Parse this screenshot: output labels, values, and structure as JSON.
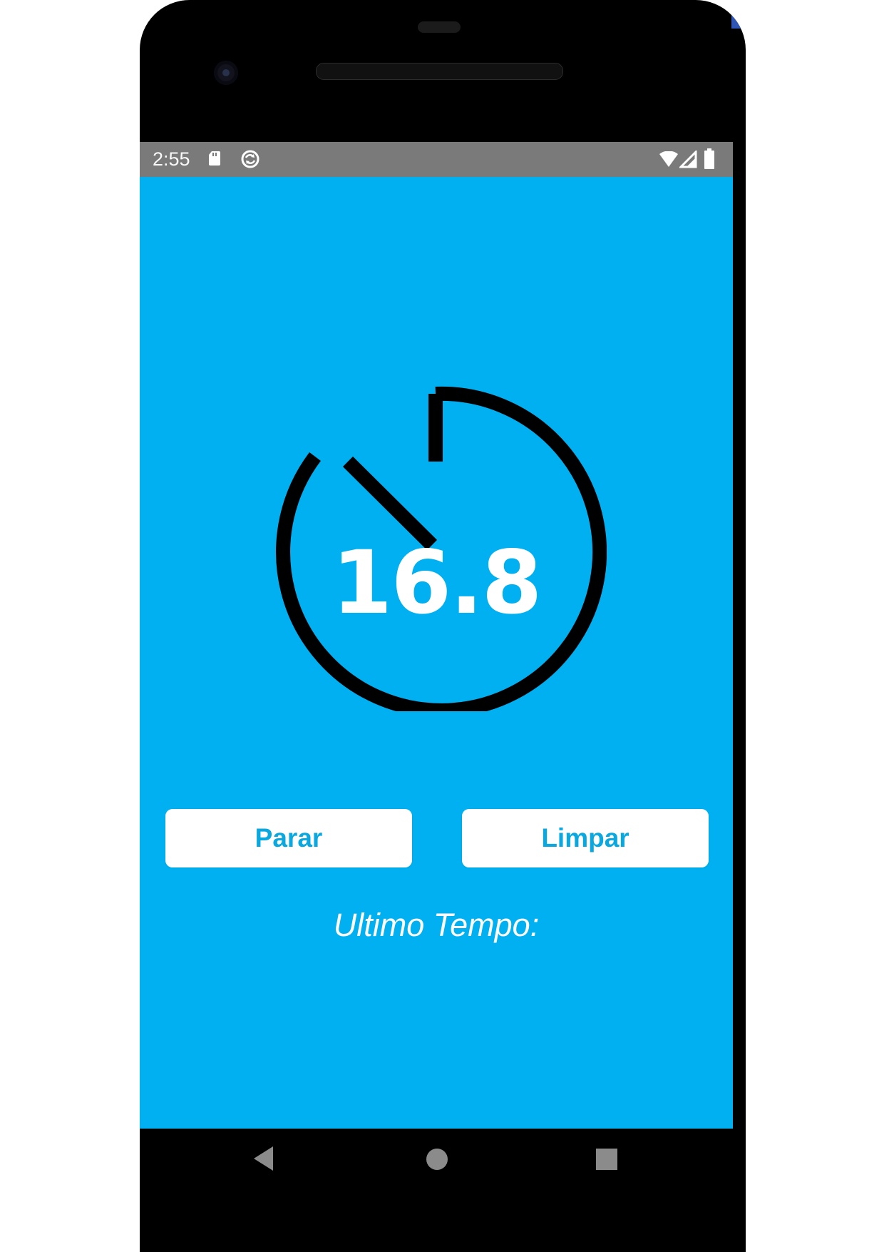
{
  "status_bar": {
    "time": "2:55",
    "icons": [
      "sd-card-icon",
      "sync-icon",
      "wifi-icon",
      "signal-icon",
      "battery-icon"
    ]
  },
  "stopwatch": {
    "value": "16.8",
    "icon": "stopwatch-icon"
  },
  "buttons": {
    "stop_label": "Parar",
    "clear_label": "Limpar"
  },
  "last_time": {
    "label": "Ultimo Tempo:"
  },
  "navigation": {
    "icons": [
      "back-icon",
      "home-icon",
      "recent-apps-icon"
    ]
  },
  "colors": {
    "screen_background": "#00b0f0",
    "status_bar": "#7a7a7a",
    "button_background": "#ffffff",
    "button_text": "#0ba8df",
    "stopwatch_stroke": "#000000",
    "primary_text": "#ffffff"
  }
}
